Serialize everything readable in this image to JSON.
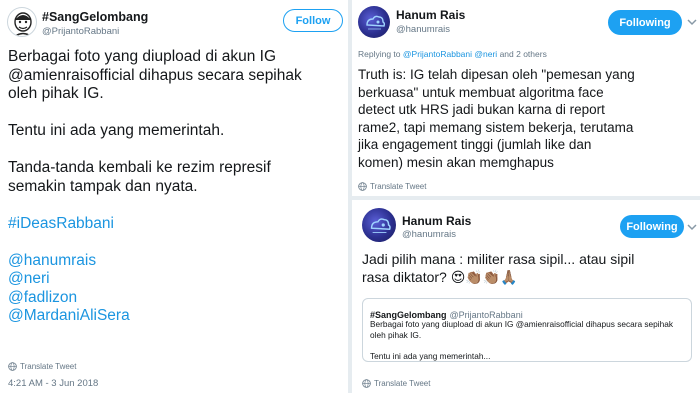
{
  "left_tweet": {
    "display_name": "#SangGelombang",
    "handle": "@PrijantoRabbani",
    "follow_label": "Follow",
    "paragraphs": [
      [
        "Berbagai foto yang diupload di akun IG",
        "@amienraisofficial dihapus secara sepihak",
        "oleh pihak IG."
      ],
      [
        "Tentu ini ada yang memerintah."
      ],
      [
        "Tanda-tanda kembali ke rezim represif",
        "semakin tampak dan nyata."
      ]
    ],
    "hashtag": "#iDeasRabbani",
    "mentions": [
      "@hanumrais",
      "@neri",
      "@fadlizon",
      "@MardaniAliSera"
    ],
    "translate_label": "Translate Tweet",
    "timestamp": "4:21 AM - 3 Jun 2018"
  },
  "right_reply": {
    "display_name": "Hanum Rais",
    "handle": "@hanumrais",
    "following_label": "Following",
    "replying_prefix": "Replying to",
    "replying_users": "@PrijantoRabbani @neri",
    "replying_suffix": "and 2 others",
    "lines": [
      "Truth is: IG telah dipesan oleh \"pemesan yang",
      "berkuasa\" untuk membuat algoritma face",
      "detect utk HRS jadi bukan karna di report",
      "rame2, tapi memang sistem bekerja, terutama",
      "jika engagement tinggi (jumlah like dan",
      "komen) mesin akan memghapus"
    ],
    "translate_label": "Translate Tweet"
  },
  "right_quote_tweet": {
    "display_name": "Hanum Rais",
    "handle": "@hanumrais",
    "following_label": "Following",
    "lines": [
      "Jadi pilih mana : militer rasa sipil... atau sipil",
      "rasa diktator?"
    ],
    "emojis": [
      "😍",
      "👏🏽",
      "👏🏽",
      "🙏🏽"
    ],
    "quoted": {
      "display_name": "#SangGelombang",
      "handle": "@PrijantoRabbani",
      "lines": [
        "Berbagai foto yang diupload di akun IG @amienraisofficial dihapus secara sepihak",
        "oleh pihak IG."
      ],
      "second_paragraph": "Tentu ini ada yang memerintah..."
    },
    "translate_label": "Translate Tweet"
  },
  "colors": {
    "link": "#1b95e0",
    "follow_blue": "#1da1f2",
    "secondary_text": "#657786",
    "border": "#ccd6dd"
  }
}
